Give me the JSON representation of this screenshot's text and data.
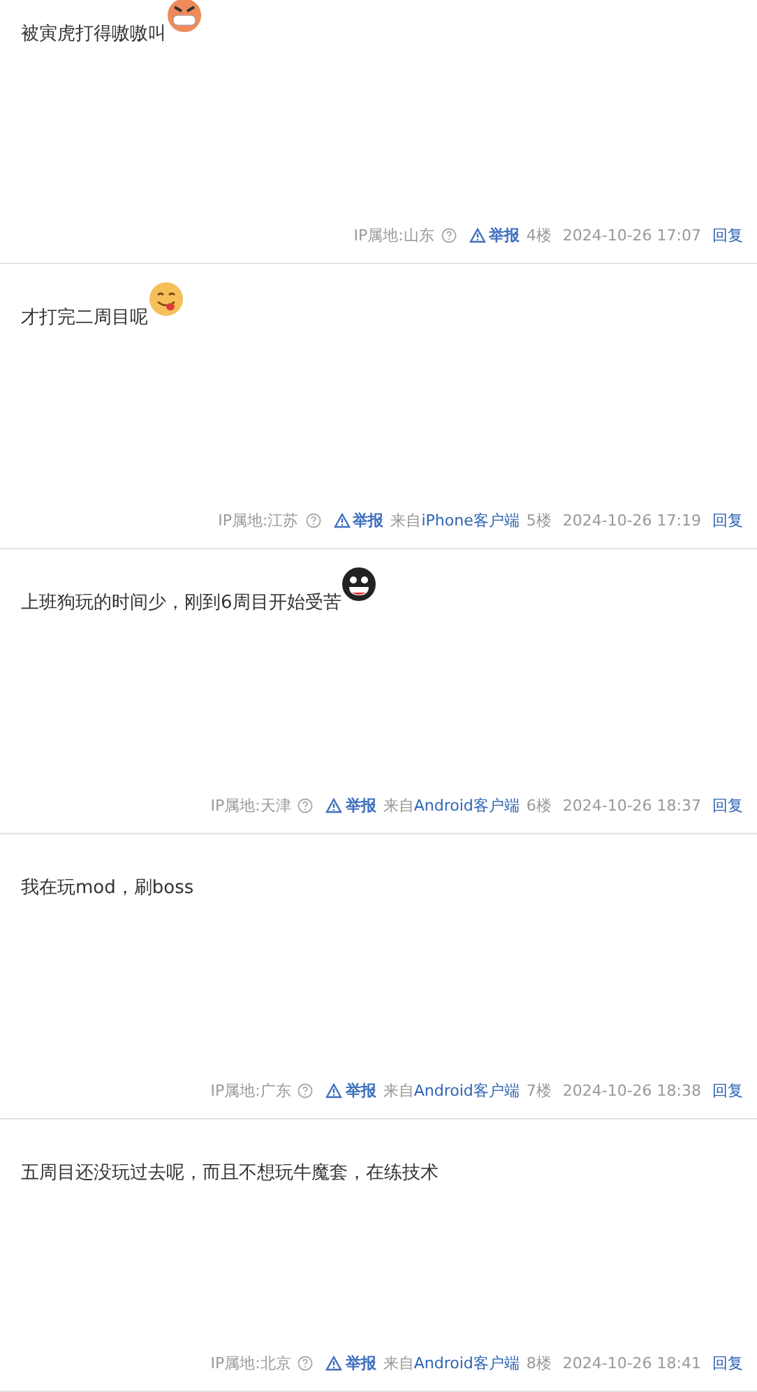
{
  "posts": [
    {
      "text": "被寅虎打得嗷嗷叫",
      "emoji": {
        "kind": "angry"
      },
      "ip": "IP属地:山东",
      "report": "举报",
      "floor": "4楼",
      "time": "2024-10-26 17:07",
      "reply": "回复"
    },
    {
      "text": "才打完二周目呢",
      "emoji": {
        "kind": "tongue"
      },
      "ip": "IP属地:江苏",
      "report": "举报",
      "client_prefix": "来自",
      "client": "iPhone客户端",
      "floor": "5楼",
      "time": "2024-10-26 17:19",
      "reply": "回复"
    },
    {
      "text": "上班狗玩的时间少，刚到6周目开始受苦",
      "emoji": {
        "kind": "grin"
      },
      "ip": "IP属地:天津",
      "report": "举报",
      "client_prefix": "来自",
      "client": "Android客户端",
      "floor": "6楼",
      "time": "2024-10-26 18:37",
      "reply": "回复"
    },
    {
      "text": "我在玩mod，刷boss",
      "ip": "IP属地:广东",
      "report": "举报",
      "client_prefix": "来自",
      "client": "Android客户端",
      "floor": "7楼",
      "time": "2024-10-26 18:38",
      "reply": "回复"
    },
    {
      "text": "五周目还没玩过去呢，而且不想玩牛魔套，在练技术",
      "ip": "IP属地:北京",
      "report": "举报",
      "client_prefix": "来自",
      "client": "Android客户端",
      "floor": "8楼",
      "time": "2024-10-26 18:41",
      "reply": "回复"
    }
  ]
}
